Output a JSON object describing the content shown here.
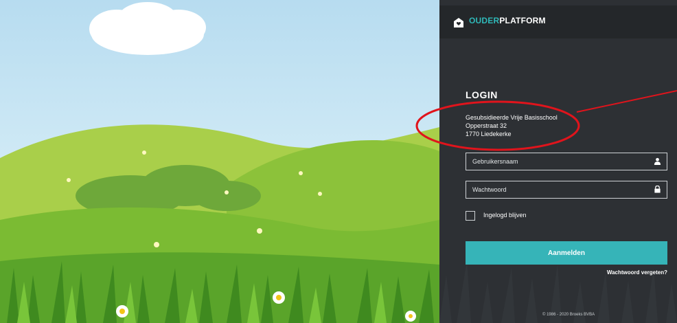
{
  "brand": {
    "name_accent": "OUDER",
    "name_rest": "PLATFORM",
    "accent_color": "#2fb8b8",
    "icon": "home-heart-icon"
  },
  "login": {
    "title": "LOGIN",
    "school_lines": [
      "Gesubsidieerde Vrije Basisschool",
      "Opperstraat 32",
      "1770 Liedekerke"
    ],
    "username_placeholder": "Gebruikersnaam",
    "username_icon": "user-icon",
    "password_placeholder": "Wachtwoord",
    "password_icon": "lock-icon",
    "remember_label": "Ingelogd blijven",
    "submit_label": "Aanmelden",
    "button_color": "#36b4b8",
    "forgot_label": "Wachtwoord vergeten?"
  },
  "footer": {
    "copyright": "© 1986 - 2020 Broeks BVBA"
  },
  "annotation": {
    "color": "#e0141c"
  }
}
